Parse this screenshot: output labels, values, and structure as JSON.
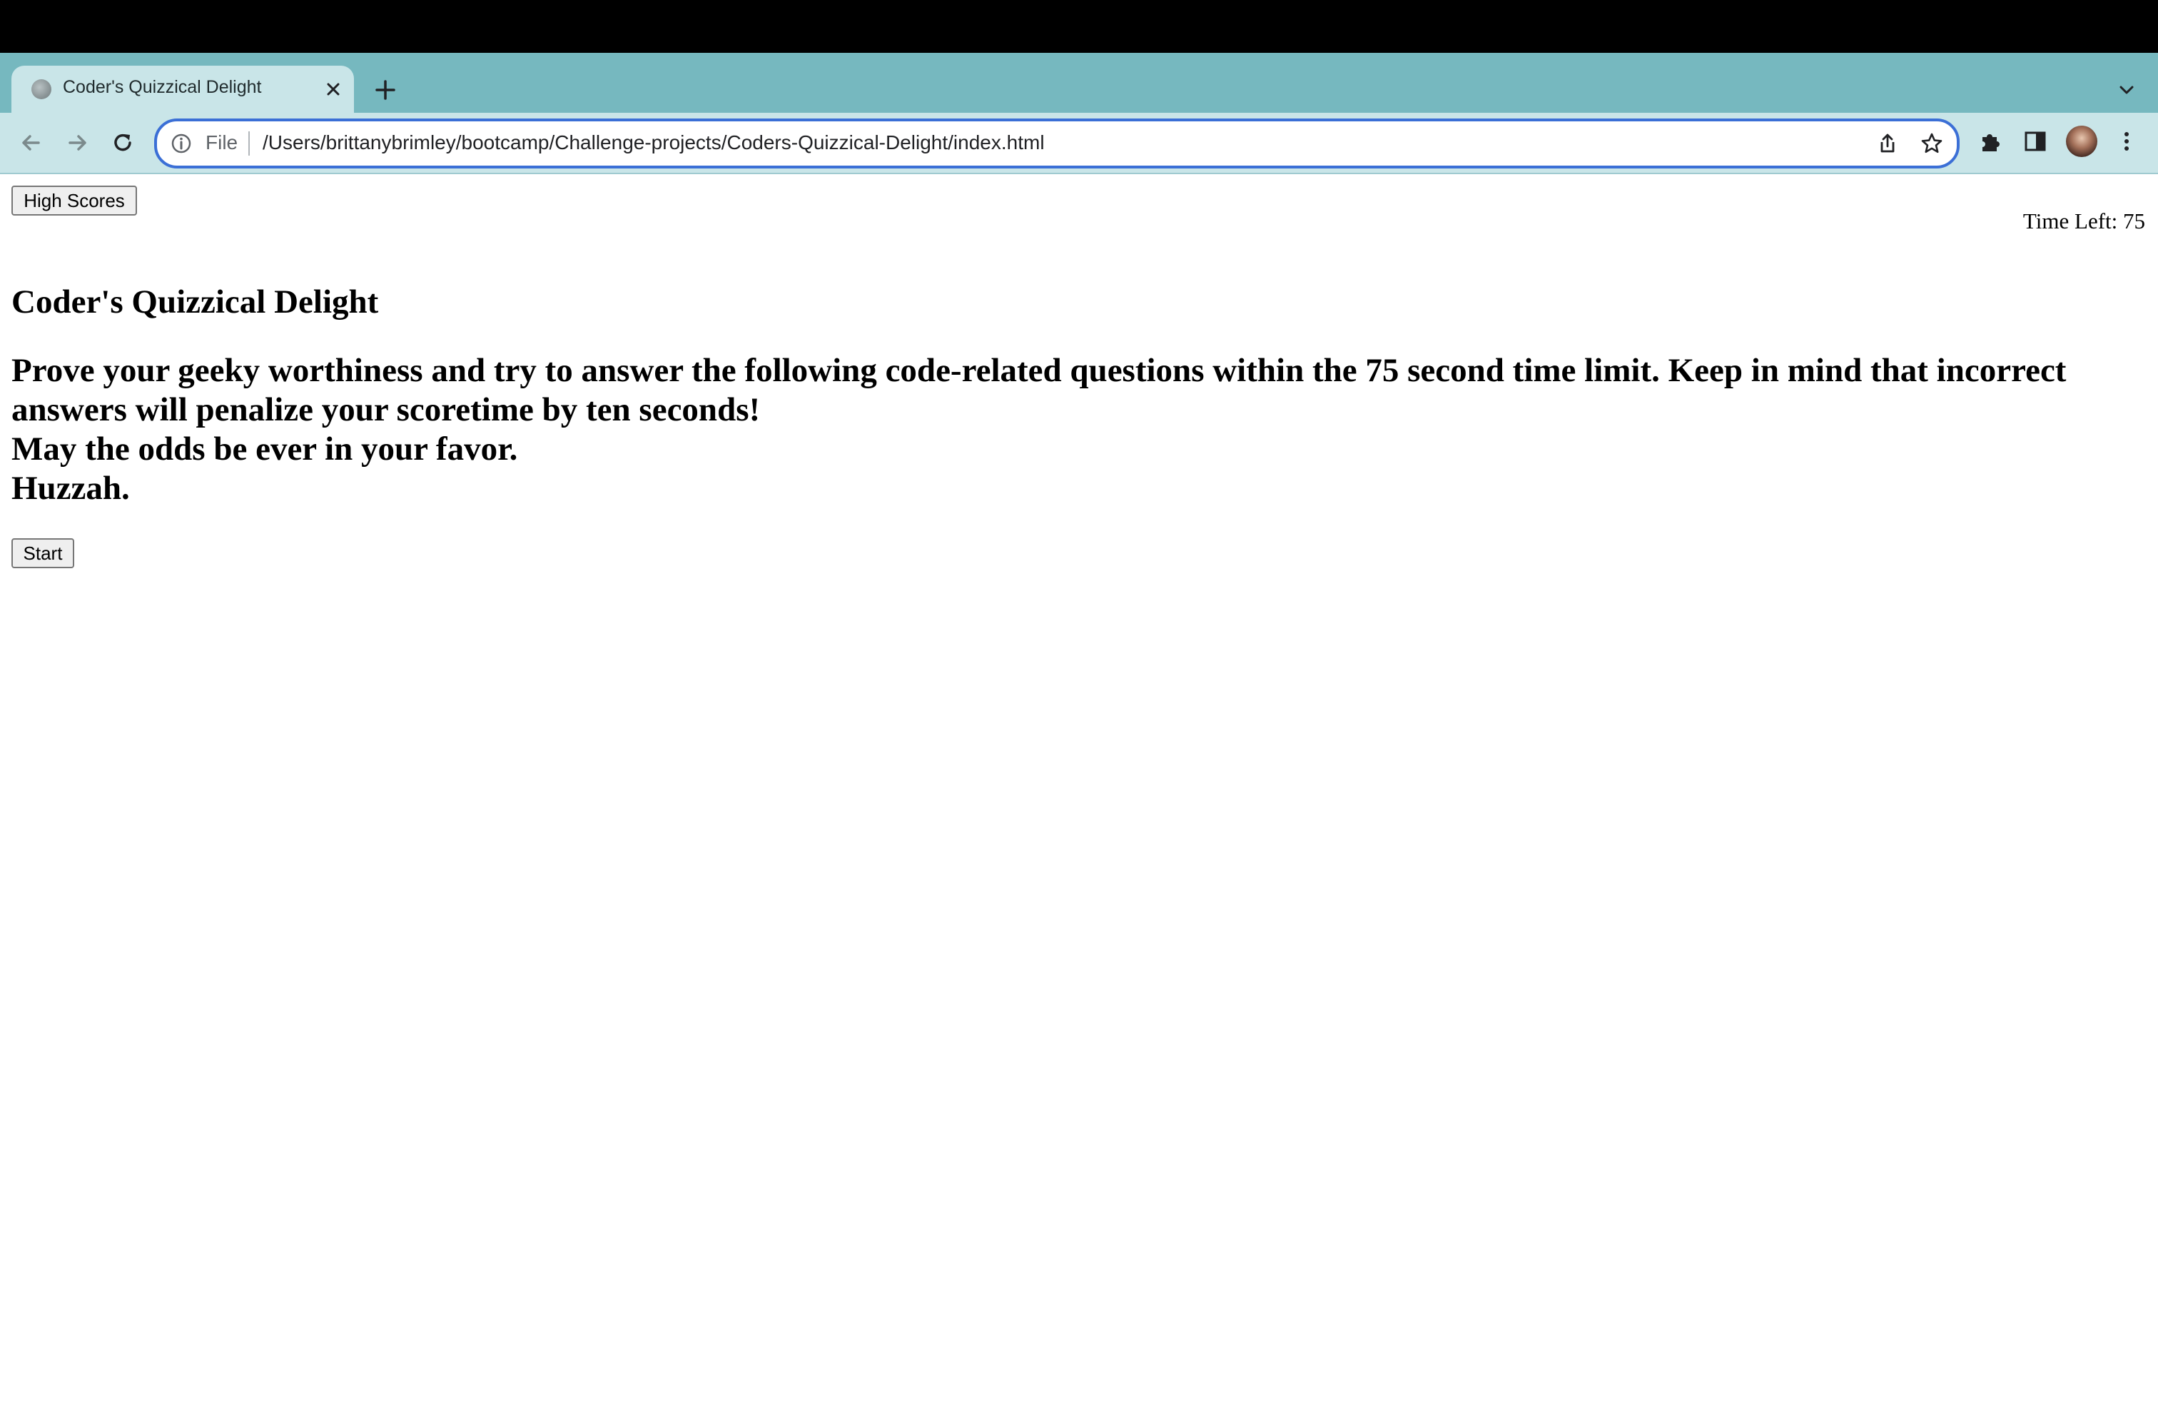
{
  "browser": {
    "tab": {
      "title": "Coder's Quizzical Delight",
      "favicon": "globe-icon",
      "close_icon": "close-icon"
    },
    "new_tab_icon": "plus-icon",
    "tab_menu_icon": "chevron-down-icon",
    "toolbar": {
      "back_icon": "back-arrow-icon",
      "forward_icon": "forward-arrow-icon",
      "reload_icon": "reload-icon",
      "address": {
        "info_icon": "info-icon",
        "scheme_label": "File",
        "url": "/Users/brittanybrimley/bootcamp/Challenge-projects/Coders-Quizzical-Delight/index.html",
        "share_icon": "share-icon",
        "bookmark_icon": "star-icon"
      },
      "extensions_icon": "puzzle-icon",
      "side_panel_icon": "side-panel-icon",
      "profile": "avatar",
      "menu_icon": "kebab-menu-icon"
    },
    "colors": {
      "tabstrip": "#76b8bf",
      "toolbar": "#c9e5e8",
      "address_focus": "#3b6fd6"
    }
  },
  "page": {
    "high_scores_label": "High Scores",
    "timer": {
      "label": "Time Left:",
      "value": "75"
    },
    "title": "Coder's Quizzical Delight",
    "intro_lines": [
      "Prove your geeky worthiness and try to answer the following code-related questions within the 75 second time limit. Keep in mind that incorrect answers will penalize your scoretime by ten seconds!",
      "May the odds be ever in your favor.",
      "Huzzah."
    ],
    "start_label": "Start"
  }
}
